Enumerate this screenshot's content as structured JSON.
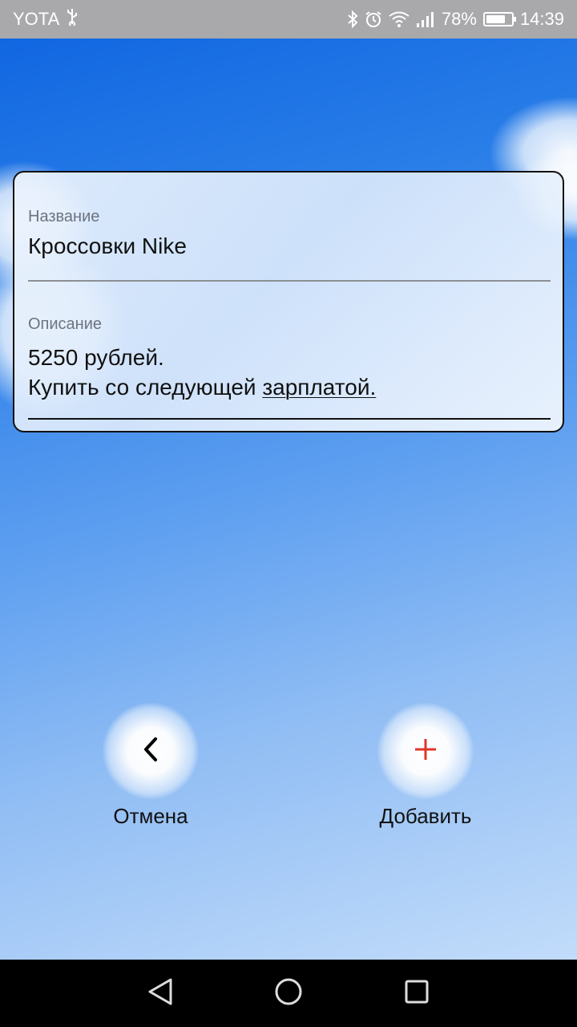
{
  "status_bar": {
    "carrier": "YOTA",
    "usb_icon": "usb-icon",
    "icons": [
      "bluetooth-icon",
      "alarm-icon",
      "wifi-icon",
      "signal-icon"
    ],
    "battery_percent": "78%",
    "battery_level": 0.78,
    "time": "14:39"
  },
  "form": {
    "name_label": "Название",
    "name_value": "Кроссовки Nike",
    "description_label": "Описание",
    "description_line1": "5250 рублей.",
    "description_line2_prefix": "Купить со следующей ",
    "description_line2_underlined": "зарплатой."
  },
  "actions": {
    "cancel_label": "Отмена",
    "cancel_icon": "chevron-left-icon",
    "add_label": "Добавить",
    "add_icon": "plus-icon",
    "add_color": "#e0342a"
  },
  "nav_bar": {
    "icons": [
      "back-triangle-icon",
      "home-circle-icon",
      "recents-square-icon"
    ]
  }
}
